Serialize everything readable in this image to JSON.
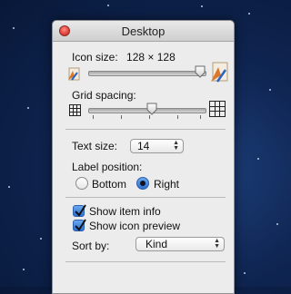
{
  "window": {
    "title": "Desktop"
  },
  "icon_size": {
    "label": "Icon size:",
    "value": "128 × 128",
    "slider_level": 0.97
  },
  "grid_spacing": {
    "label": "Grid spacing:",
    "slider_level": 0.62
  },
  "text_size": {
    "label": "Text size:",
    "selected": "14"
  },
  "label_position": {
    "label": "Label position:",
    "options": [
      {
        "label": "Bottom",
        "selected": false
      },
      {
        "label": "Right",
        "selected": true
      }
    ]
  },
  "checkboxes": [
    {
      "label": "Show item info",
      "checked": true
    },
    {
      "label": "Show icon preview",
      "checked": true
    }
  ],
  "sort_by": {
    "label": "Sort by:",
    "selected": "Kind"
  }
}
